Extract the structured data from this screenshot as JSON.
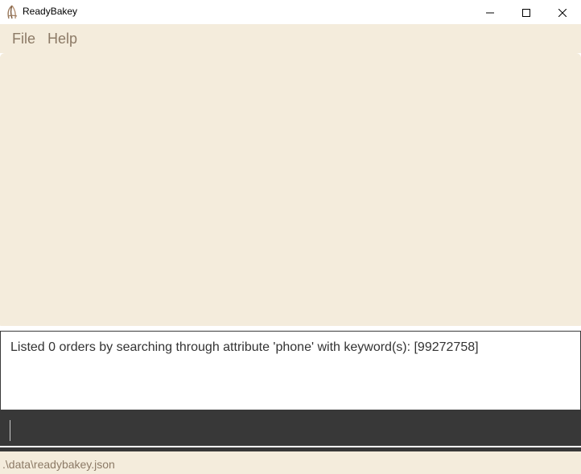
{
  "window": {
    "title": "ReadyBakey",
    "app_icon": "readybakey-logo-icon",
    "controls": [
      "minimize-icon",
      "maximize-icon",
      "close-icon"
    ]
  },
  "menu": {
    "items": [
      {
        "label": "File"
      },
      {
        "label": "Help"
      }
    ]
  },
  "order_list": {
    "items": []
  },
  "result": {
    "text": "Listed 0 orders by searching through attribute 'phone' with keyword(s): [99272758]"
  },
  "command": {
    "value": ""
  },
  "status": {
    "file_path": ".\\data\\readybakey.json"
  },
  "colors": {
    "background": "#f4ecdc",
    "menu_text": "#8c7a66",
    "command_bg": "#383838",
    "result_bg": "#ffffff"
  }
}
